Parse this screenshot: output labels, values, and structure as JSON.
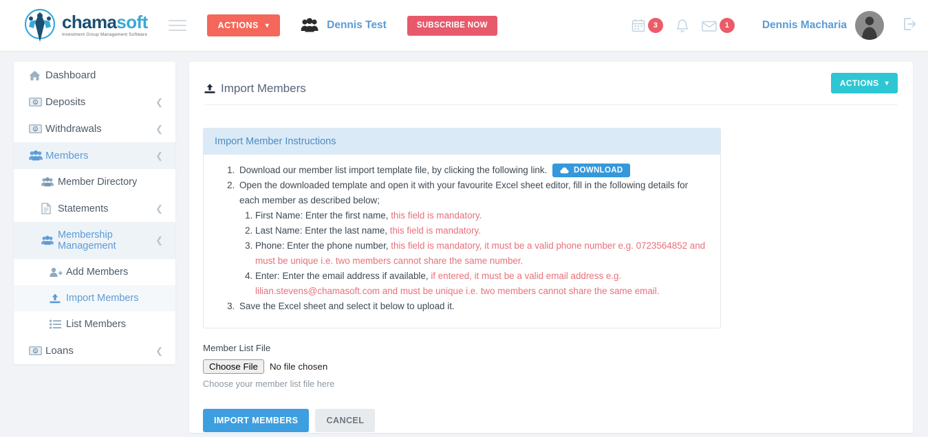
{
  "brand": {
    "name_part1": "chama",
    "name_part2": "soft",
    "tagline": "Investment Group Management Software",
    "color_dark": "#1b4f72",
    "color_light": "#3aa8d8"
  },
  "topbar": {
    "actions_label": "ACTIONS",
    "group_name": "Dennis Test",
    "subscribe_label": "SUBSCRIBE NOW",
    "calendar_badge": "3",
    "message_badge": "1",
    "username": "Dennis Macharia",
    "accent_orange": "#f4675a",
    "accent_red": "#e8596b",
    "badge_color": "#ec5b67"
  },
  "sidebar": {
    "items": [
      {
        "label": "Dashboard",
        "icon": "home-icon",
        "chevron": false,
        "level": 0,
        "active": false
      },
      {
        "label": "Deposits",
        "icon": "money-icon",
        "chevron": true,
        "level": 0,
        "active": false
      },
      {
        "label": "Withdrawals",
        "icon": "money-icon",
        "chevron": true,
        "level": 0,
        "active": false
      },
      {
        "label": "Members",
        "icon": "users-icon",
        "chevron": true,
        "level": 0,
        "active": true
      },
      {
        "label": "Member Directory",
        "icon": "users-icon",
        "chevron": false,
        "level": 1,
        "active": false
      },
      {
        "label": "Statements",
        "icon": "document-icon",
        "chevron": true,
        "level": 1,
        "active": false
      },
      {
        "label": "Membership Management",
        "icon": "users-icon",
        "chevron": true,
        "level": 1,
        "active": true
      },
      {
        "label": "Add Members",
        "icon": "user-plus-icon",
        "chevron": false,
        "level": 2,
        "active": false
      },
      {
        "label": "Import Members",
        "icon": "upload-icon",
        "chevron": false,
        "level": 2,
        "active": true
      },
      {
        "label": "List Members",
        "icon": "list-icon",
        "chevron": false,
        "level": 2,
        "active": false
      },
      {
        "label": "Loans",
        "icon": "money-icon",
        "chevron": true,
        "level": 0,
        "active": false
      }
    ]
  },
  "main": {
    "page_title": "Import Members",
    "actions_label": "ACTIONS",
    "actions_color": "#2ec6d3",
    "panel_title": "Import Member Instructions",
    "instructions": {
      "step1_text": "Download our member list import template file, by clicking the following link.",
      "download_label": "DOWNLOAD",
      "step2_text": "Open the downloaded template and open it with your favourite Excel sheet editor, fill in the following details for each member as described below;",
      "sub_items": [
        {
          "normal_a": "First Name: Enter the first name, ",
          "mandatory": "this field is mandatory.",
          "normal_b": ""
        },
        {
          "normal_a": "Last Name: Enter the last name, ",
          "mandatory": "this field is mandatory.",
          "normal_b": ""
        },
        {
          "normal_a": "Phone: Enter the phone number, ",
          "mandatory": "this field is mandatory, it must be a valid phone number e.g. 0723564852 and must be unique i.e. two members cannot share the same number.",
          "normal_b": ""
        },
        {
          "normal_a": "Enter: Enter the email address if available, ",
          "mandatory": "if entered, it must be a valid email address e.g. lilian.stevens@chamasoft.com and must be unique i.e. two members cannot share the same email.",
          "normal_b": ""
        }
      ],
      "step3_text": "Save the Excel sheet and select it below to upload it."
    },
    "file_field": {
      "label": "Member List File",
      "choose_button": "Choose File",
      "chosen_text": "No file chosen",
      "help": "Choose your member list file here"
    },
    "submit_label": "IMPORT MEMBERS",
    "cancel_label": "CANCEL"
  }
}
